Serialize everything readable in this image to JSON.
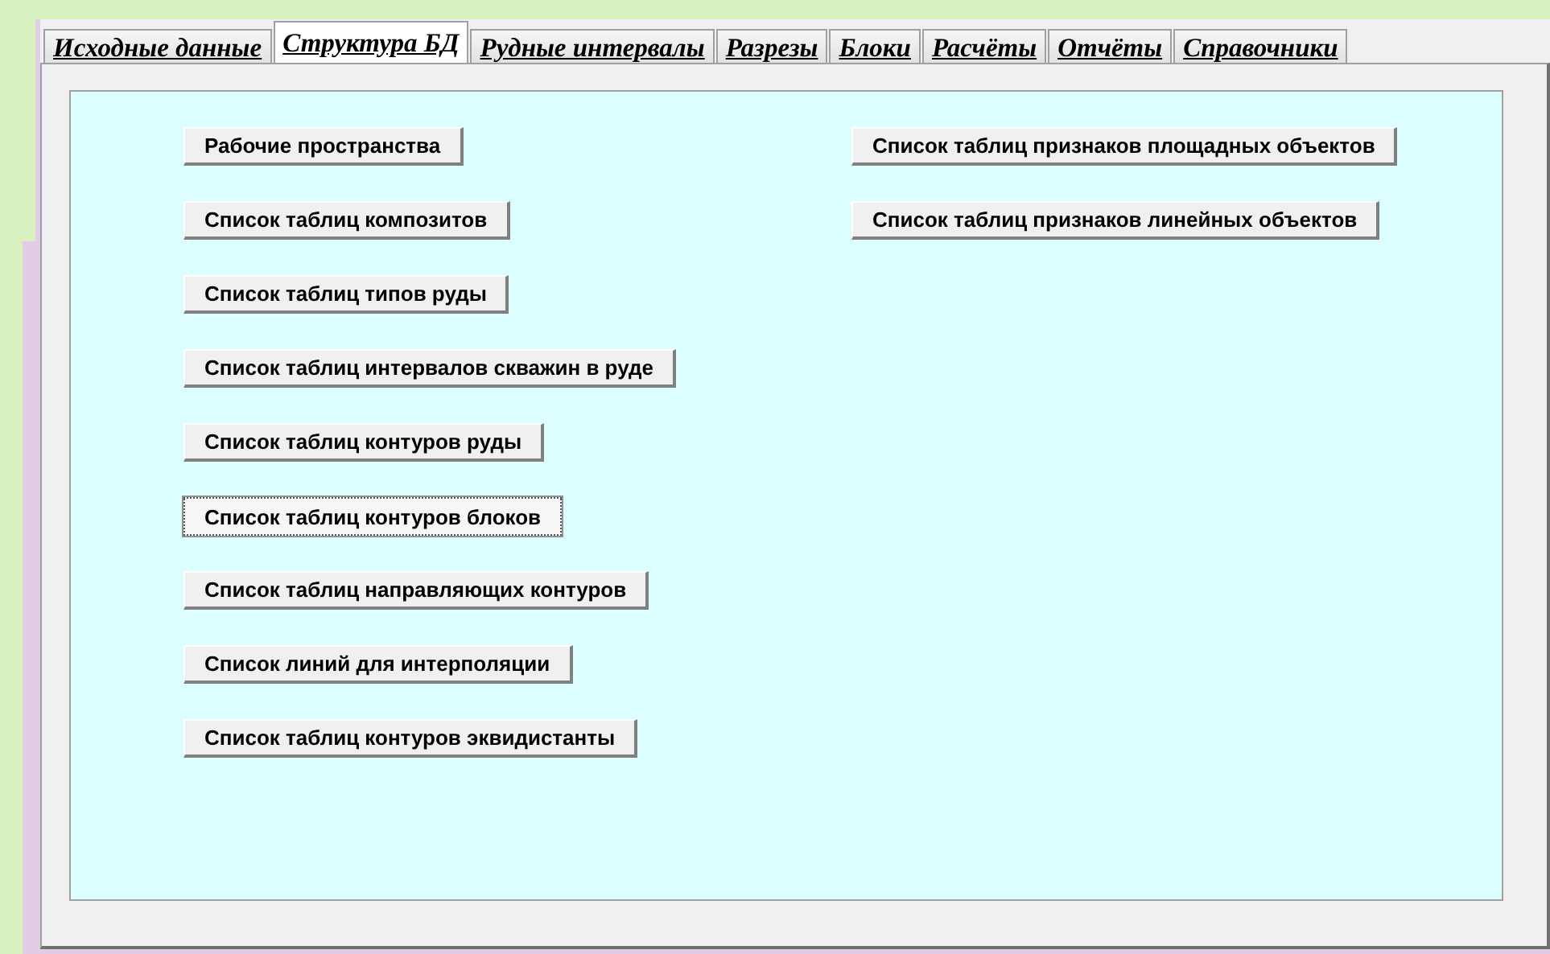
{
  "tabs": [
    {
      "label": "Исходные данные",
      "selected": false
    },
    {
      "label": "Структура БД",
      "selected": true
    },
    {
      "label": "Рудные интервалы",
      "selected": false
    },
    {
      "label": "Разрезы",
      "selected": false
    },
    {
      "label": "Блоки",
      "selected": false
    },
    {
      "label": "Расчёты",
      "selected": false
    },
    {
      "label": "Отчёты",
      "selected": false
    },
    {
      "label": "Справочники",
      "selected": false
    }
  ],
  "buttons_left": [
    {
      "label": "Рабочие пространства",
      "focused": false
    },
    {
      "label": "Список таблиц композитов",
      "focused": false
    },
    {
      "label": "Список таблиц типов руды",
      "focused": false
    },
    {
      "label": "Список таблиц интервалов скважин в руде",
      "focused": false
    },
    {
      "label": "Список таблиц  контуров руды",
      "focused": false
    },
    {
      "label": "Список таблиц  контуров блоков",
      "focused": true
    },
    {
      "label": "Список таблиц направляющих контуров",
      "focused": false
    },
    {
      "label": "Список линий для интерполяции",
      "focused": false
    },
    {
      "label": "Список таблиц контуров эквидистанты",
      "focused": false
    }
  ],
  "buttons_right": [
    {
      "label": "Список таблиц признаков площадных объектов",
      "focused": false
    },
    {
      "label": "Список таблиц признаков линейных объектов",
      "focused": false
    }
  ]
}
